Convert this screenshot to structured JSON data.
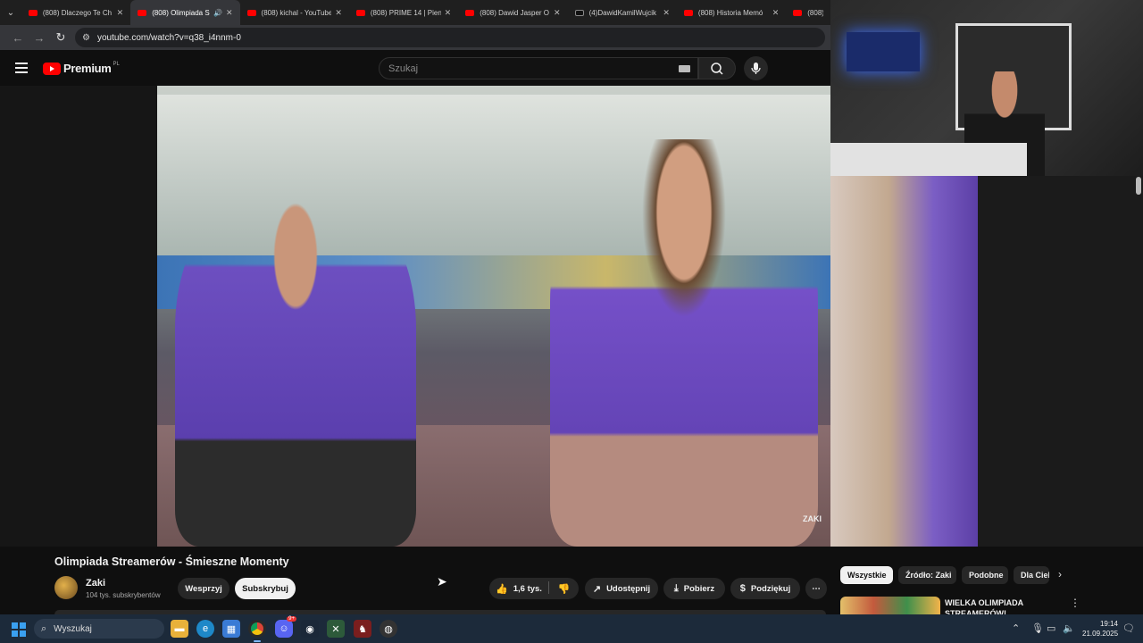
{
  "browser": {
    "tabs": [
      {
        "title": "(808) Dlaczego Te Ch",
        "icon": "youtube-favicon"
      },
      {
        "title": "(808) Olimpiada S",
        "icon": "youtube-favicon",
        "active": true,
        "audio": true
      },
      {
        "title": "(808) kichal - YouTube",
        "icon": "youtube-favicon"
      },
      {
        "title": "(808) PRIME 14 | Pien",
        "icon": "youtube-favicon"
      },
      {
        "title": "(808) Dawid Jasper O",
        "icon": "youtube-favicon"
      },
      {
        "title": "(4)DawidKamilWujcik",
        "icon": "tiktok-favicon"
      },
      {
        "title": "(808) Historia Memó",
        "icon": "youtube-favicon"
      },
      {
        "title": "(808)",
        "icon": "youtube-favicon"
      }
    ],
    "url": "youtube.com/watch?v=q38_i4nnm-0"
  },
  "youtube": {
    "logo_text": "Premium",
    "country_code": "PL",
    "search_placeholder": "Szukaj",
    "video_watermark": "ZAKI",
    "video_title": "Olimpiada Streamerów - Śmieszne Momenty",
    "channel": {
      "name": "Zaki",
      "subscribers": "104 tys. subskrybentów"
    },
    "buttons": {
      "support": "Wesprzyj",
      "subscribe": "Subskrybuj",
      "like_count": "1,6 tys.",
      "share": "Udostępnij",
      "download": "Pobierz",
      "thanks": "Podziękuj"
    },
    "chips": [
      "Wszystkie",
      "Źródło: Zaki",
      "Podobne",
      "Dla Ciebie"
    ],
    "recommendation_title": "WIELKA OLIMPIADA STREAMERÓW!"
  },
  "taskbar": {
    "search_placeholder": "Wyszukaj",
    "discord_badge": "9+",
    "time": "19:14",
    "date": "21.09.2025"
  },
  "colors": {
    "youtube_red": "#ff0000",
    "background": "#0f0f0f",
    "chip_selected": "#f1f1f1",
    "taskbar": "#1c2a3a"
  }
}
